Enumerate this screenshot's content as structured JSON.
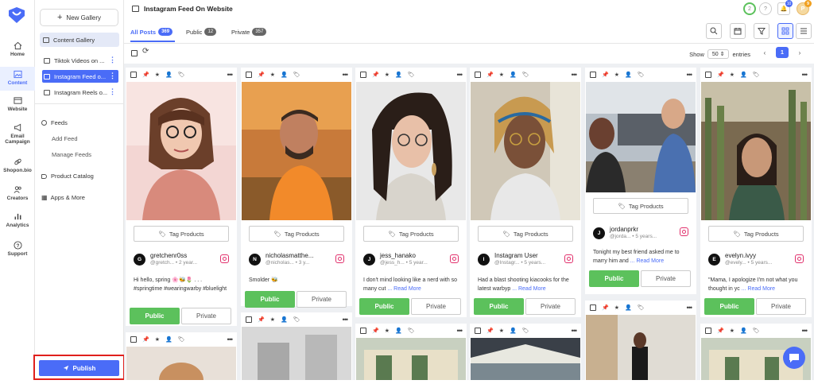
{
  "rail": {
    "items": [
      {
        "label": "Home",
        "icon": "home-icon"
      },
      {
        "label": "Content",
        "icon": "image-icon"
      },
      {
        "label": "Website",
        "icon": "website-icon"
      },
      {
        "label": "Email Campaign",
        "icon": "megaphone-icon"
      },
      {
        "label": "Shopon.bio",
        "icon": "link-icon"
      },
      {
        "label": "Creators",
        "icon": "users-icon"
      },
      {
        "label": "Analytics",
        "icon": "bar-chart-icon"
      },
      {
        "label": "Support",
        "icon": "help-icon"
      }
    ]
  },
  "panel": {
    "new_gallery": "New Gallery",
    "content_gallery": "Content Gallery",
    "galleries": [
      "Tiktok Videos on ...",
      "Instagram Feed o...",
      "Instagram Reels o..."
    ],
    "feeds": "Feeds",
    "add_feed": "Add Feed",
    "manage_feeds": "Manage Feeds",
    "product_catalog": "Product Catalog",
    "apps_more": "Apps & More",
    "publish": "Publish"
  },
  "header": {
    "title": "Instagram Feed On Website",
    "badge_progress": "2",
    "badge_notifications": "10",
    "badge_avatar": "9",
    "avatar_letter": "P"
  },
  "tabs": [
    {
      "label": "All Posts",
      "count": "369"
    },
    {
      "label": "Public",
      "count": "12"
    },
    {
      "label": "Private",
      "count": "357"
    }
  ],
  "controls": {
    "show_label": "Show",
    "entries_value": "50",
    "entries_label": "entries",
    "page": "1"
  },
  "cards": [
    {
      "tag": "Tag Products",
      "avatar": "G",
      "name": "gretchenr0ss",
      "handle": "@gretch...",
      "ago": "2 year...",
      "caption": "Hi hello, spring 🌸🐝🌷 . . . #springtime #wearingwarby #bluelight",
      "read_more": "",
      "public": "Public",
      "private": "Private"
    },
    {
      "tag": "Tag Products",
      "avatar": "N",
      "name": "nicholasmatthe...",
      "handle": "@nicholas...",
      "ago": "3 y...",
      "caption": "Smolder 🐝",
      "read_more": "",
      "public": "Public",
      "private": "Private"
    },
    {
      "tag": "Tag Products",
      "avatar": "J",
      "name": "jess_hanako",
      "handle": "@jess_h...",
      "ago": "5 year...",
      "caption": "I don't mind looking like a nerd with so many cut",
      "read_more": "... Read More",
      "public": "Public",
      "private": "Private"
    },
    {
      "tag": "Tag Products",
      "avatar": "I",
      "name": "Instagram User",
      "handle": "@Instagr...",
      "ago": "5 years...",
      "caption": "Had a blast shooting kiacooks for the latest warbyp",
      "read_more": "... Read More",
      "public": "Public",
      "private": "Private"
    },
    {
      "tag": "Tag Products",
      "avatar": "J",
      "name": "jordanprkr",
      "handle": "@jorda...",
      "ago": "5 years...",
      "caption": "Tonight my best friend asked me to marry him and",
      "read_more": "... Read More",
      "public": "Public",
      "private": "Private"
    },
    {
      "tag": "Tag Products",
      "avatar": "E",
      "name": "evelyn.ivyy",
      "handle": "@evely...",
      "ago": "5 years...",
      "caption": "\"Mama, I apologize I'm not what you thought in yc",
      "read_more": "... Read More",
      "public": "Public",
      "private": "Private"
    }
  ],
  "colors": {
    "accent": "#4a6cf7",
    "public_green": "#5cc15c",
    "instagram": "#e1306c",
    "highlight_red": "#e0201c"
  }
}
